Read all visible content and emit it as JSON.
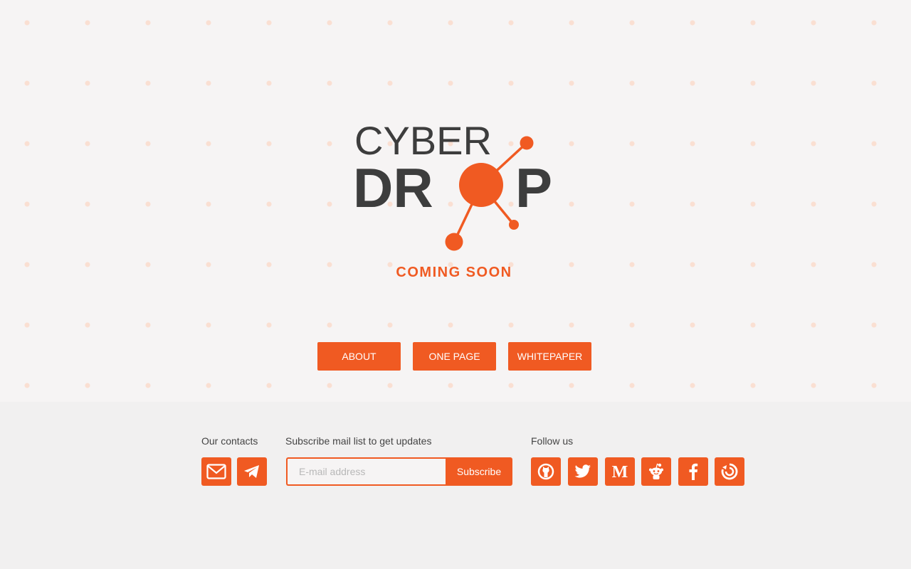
{
  "brand": {
    "line1": "CYBER",
    "line2_left": "DR",
    "line2_right": "P",
    "tagline": "COMING SOON",
    "accent": "#f05a22",
    "dark": "#3d3d3d"
  },
  "nav": [
    {
      "label": "ABOUT"
    },
    {
      "label": "ONE PAGE"
    },
    {
      "label": "WHITEPAPER"
    }
  ],
  "contacts": {
    "label": "Our contacts",
    "icons": [
      "mail-icon",
      "telegram-icon"
    ]
  },
  "subscribe": {
    "label": "Subscribe mail list to get updates",
    "placeholder": "E-mail address",
    "button": "Subscribe"
  },
  "follow": {
    "label": "Follow us",
    "icons": [
      "github-icon",
      "twitter-icon",
      "medium-icon",
      "reddit-icon",
      "facebook-icon",
      "bitcointalk-icon"
    ]
  }
}
